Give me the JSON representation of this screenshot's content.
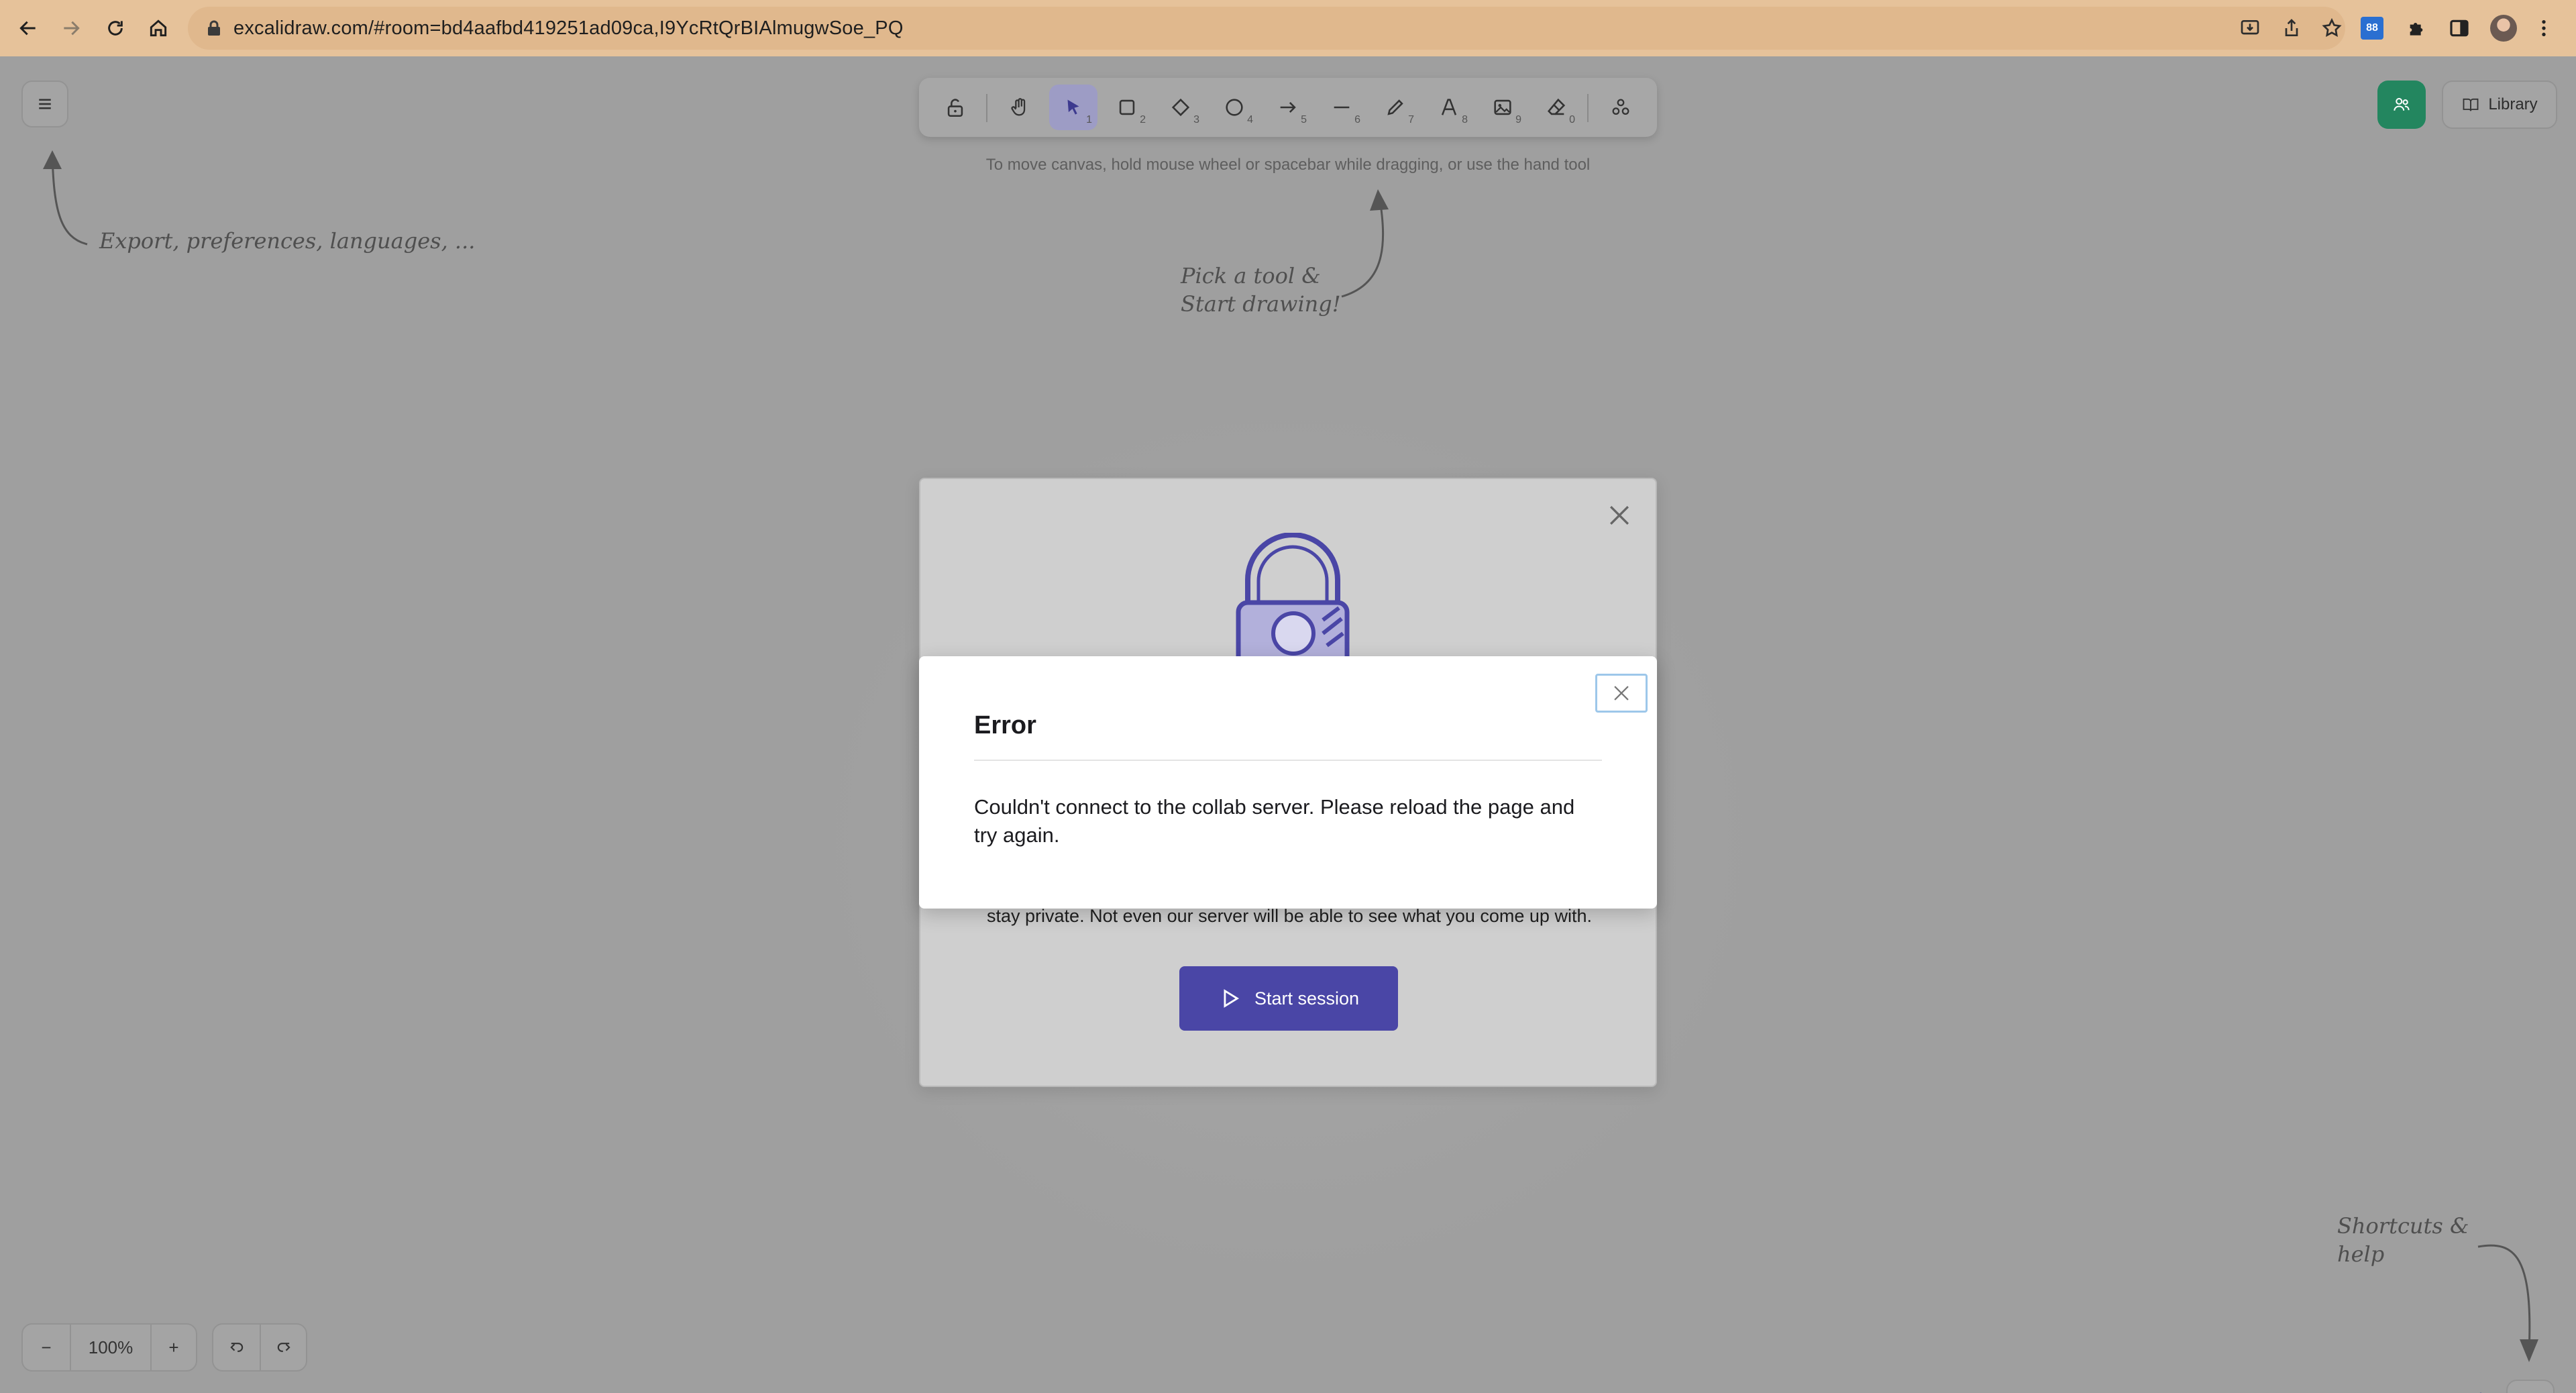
{
  "browser": {
    "url": "excalidraw.com/#room=bd4aafbd419251ad09ca,I9YcRtQrBIAlmugwSoe_PQ",
    "extension_badge": "88"
  },
  "toolbar": {
    "tools": [
      {
        "name": "hand",
        "key": ""
      },
      {
        "name": "selection",
        "key": "1"
      },
      {
        "name": "rectangle",
        "key": "2"
      },
      {
        "name": "diamond",
        "key": "3"
      },
      {
        "name": "ellipse",
        "key": "4"
      },
      {
        "name": "arrow",
        "key": "5"
      },
      {
        "name": "line",
        "key": "6"
      },
      {
        "name": "draw",
        "key": "7"
      },
      {
        "name": "text",
        "key": "8"
      },
      {
        "name": "image",
        "key": "9"
      },
      {
        "name": "eraser",
        "key": "0"
      }
    ],
    "hint": "To move canvas, hold mouse wheel or spacebar while dragging, or use the hand tool"
  },
  "welcome": {
    "menu_hint": "Export, preferences, languages, ...",
    "toolbar_hint_line1": "Pick a tool &",
    "toolbar_hint_line2": "Start drawing!",
    "help_hint_line1": "Shortcuts &",
    "help_hint_line2": "help"
  },
  "header": {
    "library_label": "Library"
  },
  "footer": {
    "zoom_out": "−",
    "zoom_level": "100%",
    "zoom_in": "+"
  },
  "collab_dialog": {
    "privacy_text": "stay private. Not even our server will be able to see what you come up with.",
    "start_session_label": "Start session"
  },
  "error_dialog": {
    "title": "Error",
    "message": "Couldn't connect to the collab server. Please reload the page and try again."
  },
  "colors": {
    "accent": "#4a46a6",
    "collab_button": "#23865f",
    "chrome_bg": "#e6c29a"
  }
}
